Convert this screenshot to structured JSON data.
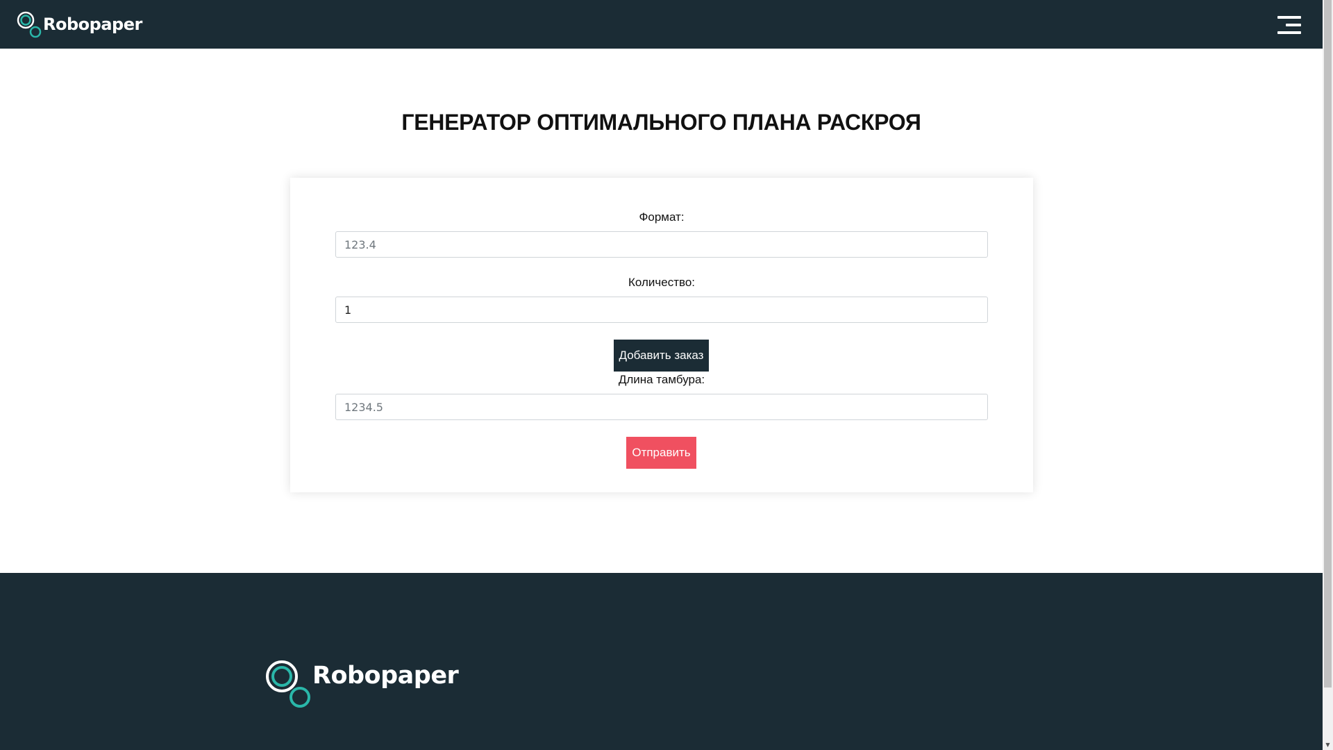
{
  "header": {
    "brand_name": "Robopaper",
    "menu_icon": "hamburger-menu-icon"
  },
  "main": {
    "title": "ГЕНЕРАТОР ОПТИМАЛЬНОГО ПЛАНА РАСКРОЯ",
    "form": {
      "format_label": "Формат:",
      "format_placeholder": "123.4",
      "format_value": "",
      "quantity_label": "Количество:",
      "quantity_value": "1",
      "add_order_label": "Добавить заказ",
      "drum_length_label": "Длина тамбура:",
      "drum_length_placeholder": "1234.5",
      "drum_length_value": "",
      "submit_label": "Отправить"
    }
  },
  "footer": {
    "brand_name": "Robopaper"
  },
  "colors": {
    "dark": "#1b2c35",
    "accent_teal": "#2ab7a9",
    "submit_red": "#f05060",
    "white": "#ffffff"
  }
}
